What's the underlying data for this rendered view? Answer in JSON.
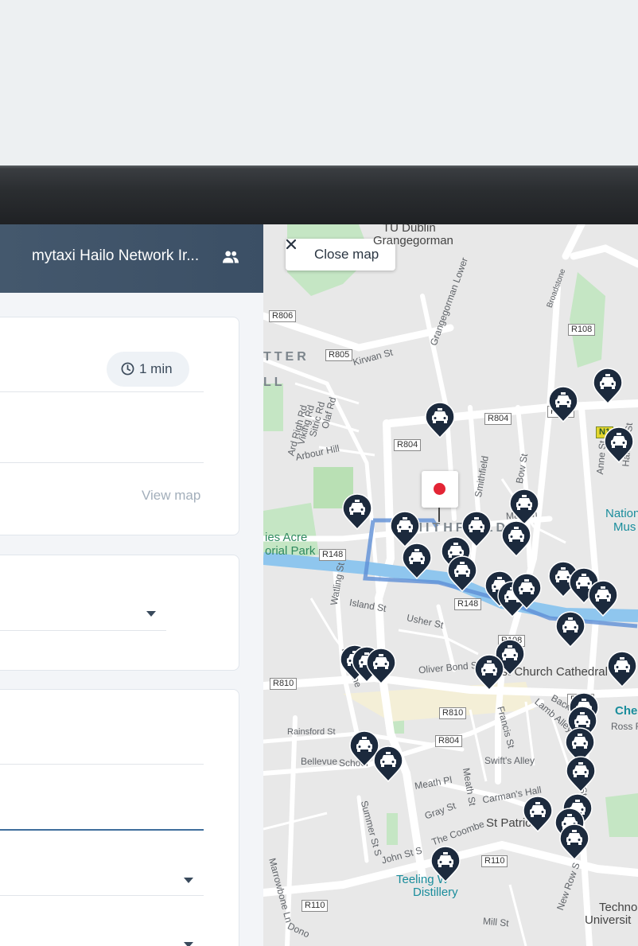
{
  "panel": {
    "title": "mytaxi Hailo Network Ir...",
    "time_estimate": "1 min",
    "view_map_label": "View map"
  },
  "map": {
    "close_label": "Close map",
    "labels": {
      "tu_dublin_1": "TU Dublin",
      "tu_dublin_2": "Grangegorman",
      "district_1": "TTER",
      "district_2": "LL",
      "smithfield": "SMITHFIELD",
      "kirwan": "Kirwan St",
      "arbour": "Arbour Hill",
      "olaf": "Olaf Rd",
      "sitric": "Sitric Rd",
      "viking": "Viking Rd",
      "ard_righ": "Ard Righ Rd",
      "grangegorman_lower": "Grangegorman Lower",
      "broadstone": "Broadstone",
      "bow": "Bow St",
      "anne": "Anne St N",
      "halston": "Halston St",
      "mays": "May Ln",
      "national_1": "Nation",
      "national_2": "Mus",
      "ellis_1": "ies Acre",
      "ellis_2": "orial Park",
      "watling": "Watling St",
      "island": "Island St",
      "usher": "Usher St",
      "roe": "Roe Lane",
      "oliver": "Oliver Bond St",
      "christ_church": "Christ Church Cathedral",
      "lamb": "Lamb Alley",
      "back": "Back Ln",
      "francis": "Francis St",
      "john_dillon": "John Dillon St",
      "rainsford": "Rainsford St",
      "bellevue": "Bellevue",
      "school": "School",
      "swifts": "Swift's Alley",
      "meath_pl": "Meath Pl",
      "meath_st": "Meath St",
      "carmans": "Carman's Hall",
      "gray": "Gray St",
      "coombe": "The Coombe",
      "st_patricks": "St Patrick",
      "ross": "Ross R",
      "summer": "Summer St S",
      "john_s": "John St S",
      "teeling_1": "Teeling W",
      "teeling_2": "Distillery",
      "new_row": "New Row S",
      "marrowbone": "Marrowbone Ln",
      "donore": "Dono",
      "mill": "Mill St",
      "techno_1": "Techno",
      "techno_2": "Universit",
      "ches": "Ches",
      "smithfield_st": "Smithfield"
    },
    "shields": [
      "R806",
      "R805",
      "R108",
      "R804",
      "R108",
      "R804",
      "N1",
      "R148",
      "R148",
      "R108",
      "R810",
      "R810",
      "R108",
      "R804",
      "R110",
      "R110"
    ]
  },
  "colors": {
    "header_bg": "#3b4f65",
    "taxi_marker": "#1c2a3d",
    "pickup_pin": "#e32535",
    "route": "#5e8fd6",
    "river": "#8fc6ee"
  },
  "icons": [
    "people-icon",
    "clock-icon",
    "caret-icon",
    "close-icon",
    "taxi-icon",
    "pickup-pin-icon"
  ]
}
